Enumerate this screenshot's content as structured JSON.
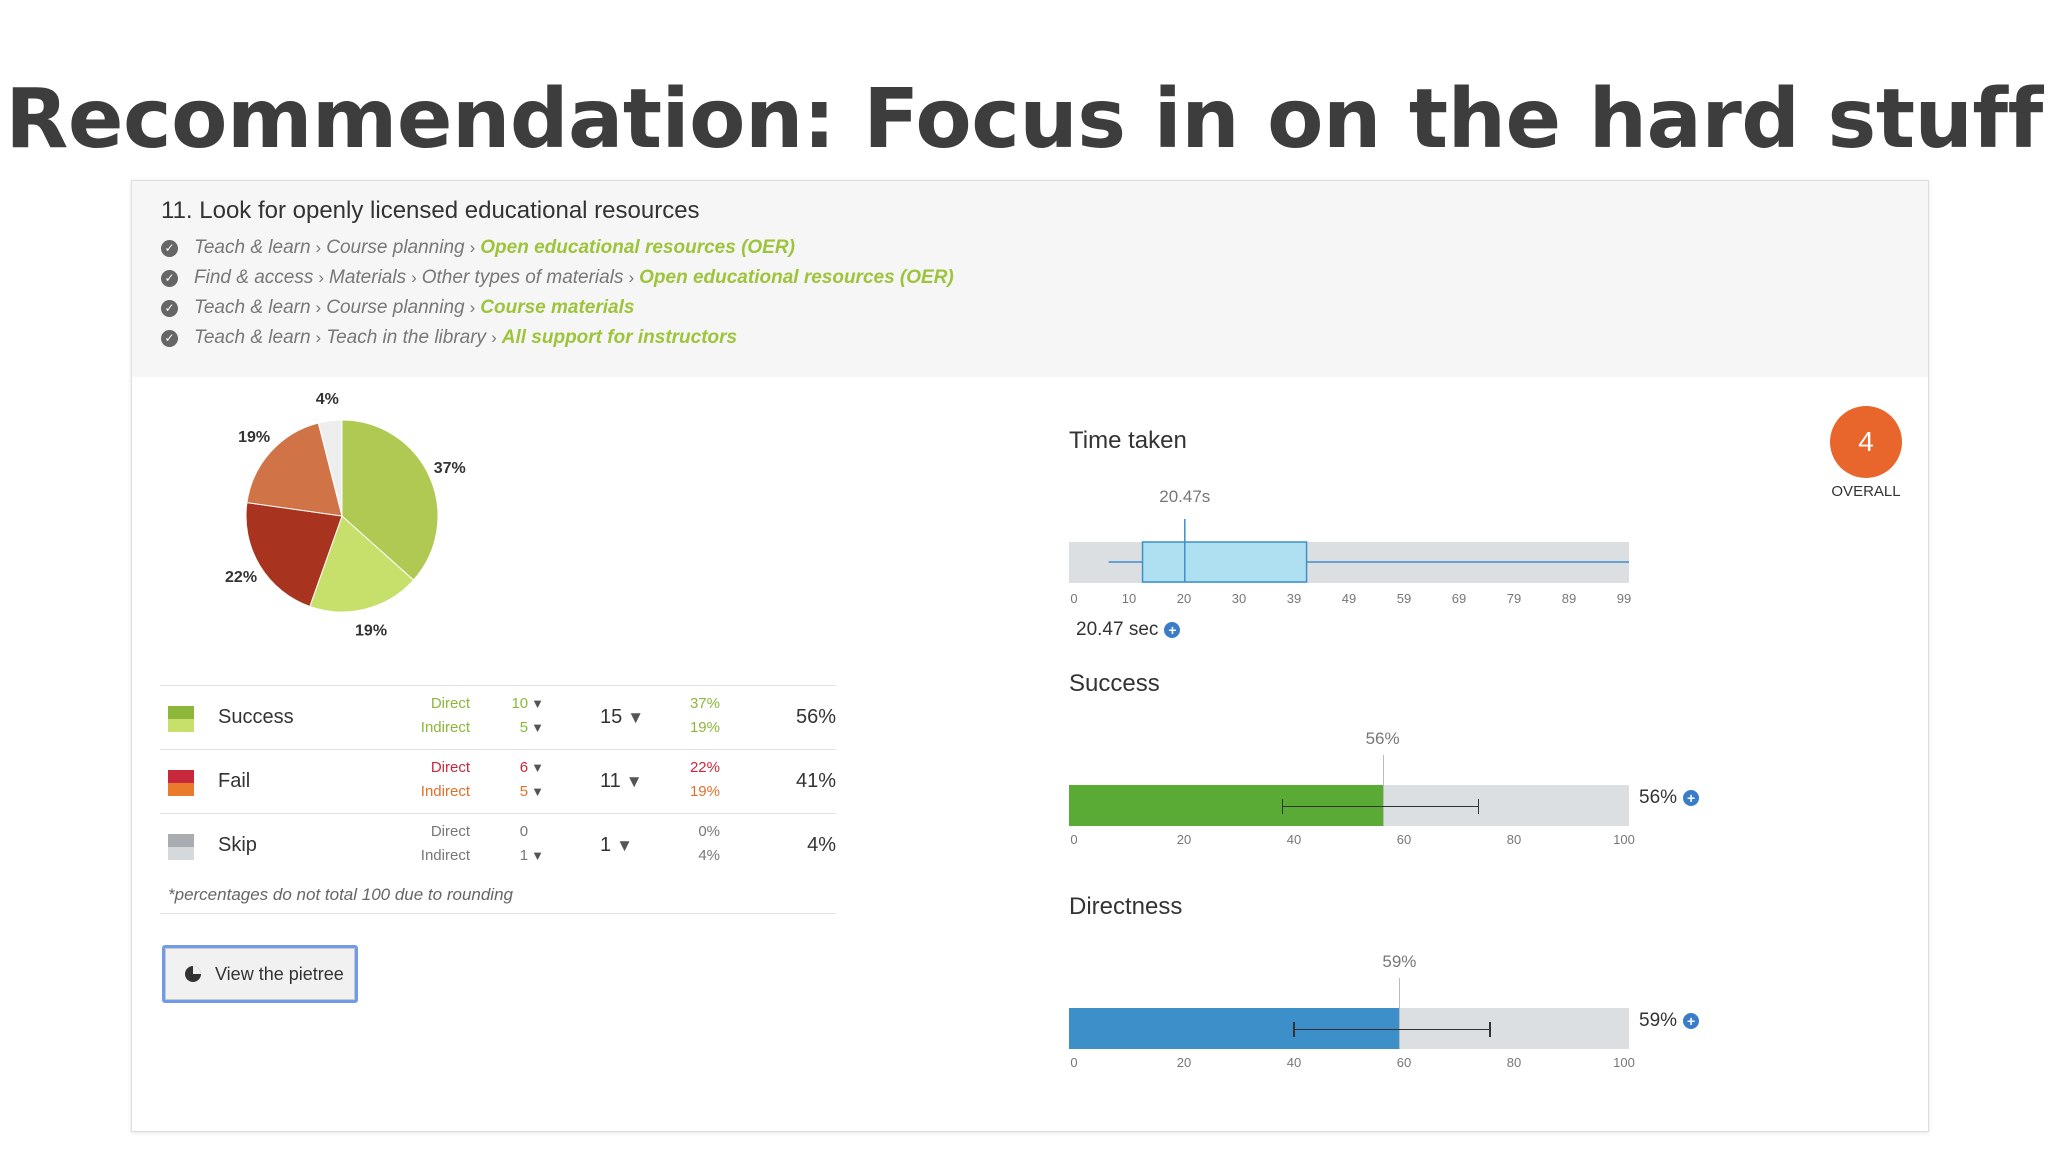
{
  "slide": {
    "title": "Recommendation: Focus in on the hard stuff"
  },
  "task": {
    "title": "11. Look for openly licensed educational resources",
    "paths": [
      {
        "crumbs": [
          "Teach & learn",
          "Course planning"
        ],
        "destination": "Open educational resources (OER)"
      },
      {
        "crumbs": [
          "Find & access",
          "Materials",
          "Other types of materials"
        ],
        "destination": "Open educational resources (OER)"
      },
      {
        "crumbs": [
          "Teach & learn",
          "Course planning"
        ],
        "destination": "Course materials"
      },
      {
        "crumbs": [
          "Teach & learn",
          "Teach in the library"
        ],
        "destination": "All support for instructors"
      }
    ]
  },
  "chart_data": [
    {
      "type": "pie",
      "slices": [
        {
          "label": "Success Direct",
          "value": 37,
          "text": "37%",
          "color": "#afc953"
        },
        {
          "label": "Success Indirect",
          "value": 19,
          "text": "19%",
          "color": "#c7df6b"
        },
        {
          "label": "Fail Direct",
          "value": 22,
          "text": "22%",
          "color": "#a8331f"
        },
        {
          "label": "Fail Indirect",
          "value": 19,
          "text": "19%",
          "color": "#d07347"
        },
        {
          "label": "Skip Indirect",
          "value": 4,
          "text": "4%",
          "color": "#eeeeee"
        }
      ]
    },
    {
      "type": "boxplot",
      "title": "Time taken",
      "median": 20.47,
      "q1": 13,
      "q3": 42,
      "whisker_low": 7,
      "whisker_high": 99,
      "median_label": "20.47s",
      "xticks": [
        "0",
        "10",
        "20",
        "30",
        "39",
        "49",
        "59",
        "69",
        "79",
        "89",
        "99"
      ],
      "xlim": [
        0,
        99
      ]
    },
    {
      "type": "bar",
      "title": "Success",
      "value": 56,
      "value_label": "56%",
      "error_low": 38,
      "error_high": 73,
      "color": "#5aaa36",
      "xticks": [
        "0",
        "20",
        "40",
        "60",
        "80",
        "100"
      ],
      "xlim": [
        0,
        100
      ]
    },
    {
      "type": "bar",
      "title": "Directness",
      "value": 59,
      "value_label": "59%",
      "error_low": 40,
      "error_high": 75,
      "color": "#3d8fc9",
      "xticks": [
        "0",
        "20",
        "40",
        "60",
        "80",
        "100"
      ],
      "xlim": [
        0,
        100
      ]
    }
  ],
  "results": {
    "rows": [
      {
        "label": "Success",
        "swatch_top": "#8db73a",
        "swatch_bottom": "#c7df6b",
        "direct_label": "Direct",
        "indirect_label": "Indirect",
        "direct_color": "#8db73a",
        "indirect_color": "#8db73a",
        "direct_count": "10",
        "indirect_count": "5",
        "total_count": "15",
        "direct_pct": "37%",
        "indirect_pct": "19%",
        "pct_color_direct": "#8db73a",
        "pct_color_indirect": "#8db73a",
        "total_pct": "56%"
      },
      {
        "label": "Fail",
        "swatch_top": "#c8283c",
        "swatch_bottom": "#ea7a2c",
        "direct_label": "Direct",
        "indirect_label": "Indirect",
        "direct_color": "#c8283c",
        "indirect_color": "#e0702a",
        "direct_count": "6",
        "indirect_count": "5",
        "total_count": "11",
        "direct_pct": "22%",
        "indirect_pct": "19%",
        "pct_color_direct": "#c8283c",
        "pct_color_indirect": "#e0702a",
        "total_pct": "41%"
      },
      {
        "label": "Skip",
        "swatch_top": "#a9adb1",
        "swatch_bottom": "#d6d9dc",
        "direct_label": "Direct",
        "indirect_label": "Indirect",
        "direct_color": "#777777",
        "indirect_color": "#777777",
        "direct_count": "0",
        "indirect_count": "1",
        "total_count": "1",
        "direct_pct": "0%",
        "indirect_pct": "4%",
        "pct_color_direct": "#777777",
        "pct_color_indirect": "#777777",
        "total_pct": "4%"
      }
    ],
    "footnote": "*percentages do not total 100 due to rounding"
  },
  "metrics": {
    "time_summary": "20.47 sec",
    "success_summary": "56%",
    "directness_summary": "59%"
  },
  "overall": {
    "score": "4",
    "label": "OVERALL"
  },
  "pietree_button": {
    "label": "View the pietree"
  },
  "icons": {
    "check": "check-circle-icon",
    "funnel": "filter-icon",
    "plus": "plus-circle-icon",
    "pie": "pie-chart-icon"
  }
}
